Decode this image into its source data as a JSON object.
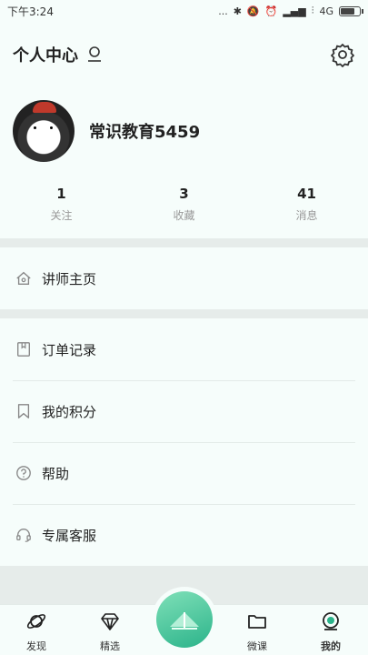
{
  "status_bar": {
    "time": "下午3:24",
    "dots": "...",
    "network": "4G"
  },
  "header": {
    "title": "个人中心"
  },
  "profile": {
    "username": "常识教育5459"
  },
  "stats": [
    {
      "value": "1",
      "label": "关注"
    },
    {
      "value": "3",
      "label": "收藏"
    },
    {
      "value": "41",
      "label": "消息"
    }
  ],
  "menu": {
    "lecturer": "讲师主页",
    "items": [
      {
        "label": "订单记录",
        "icon": "receipt-icon"
      },
      {
        "label": "我的积分",
        "icon": "bookmark-icon"
      },
      {
        "label": "帮助",
        "icon": "help-icon"
      },
      {
        "label": "专属客服",
        "icon": "headset-icon"
      }
    ]
  },
  "tabbar": {
    "tabs": [
      {
        "label": "发现",
        "icon": "planet-icon"
      },
      {
        "label": "精选",
        "icon": "diamond-icon"
      },
      {
        "label": "微课",
        "icon": "folder-icon"
      },
      {
        "label": "我的",
        "icon": "user-circle-icon"
      }
    ]
  },
  "colors": {
    "background": "#f6fdfb",
    "accent": "#2bb38a",
    "divider": "#e6ecea"
  }
}
